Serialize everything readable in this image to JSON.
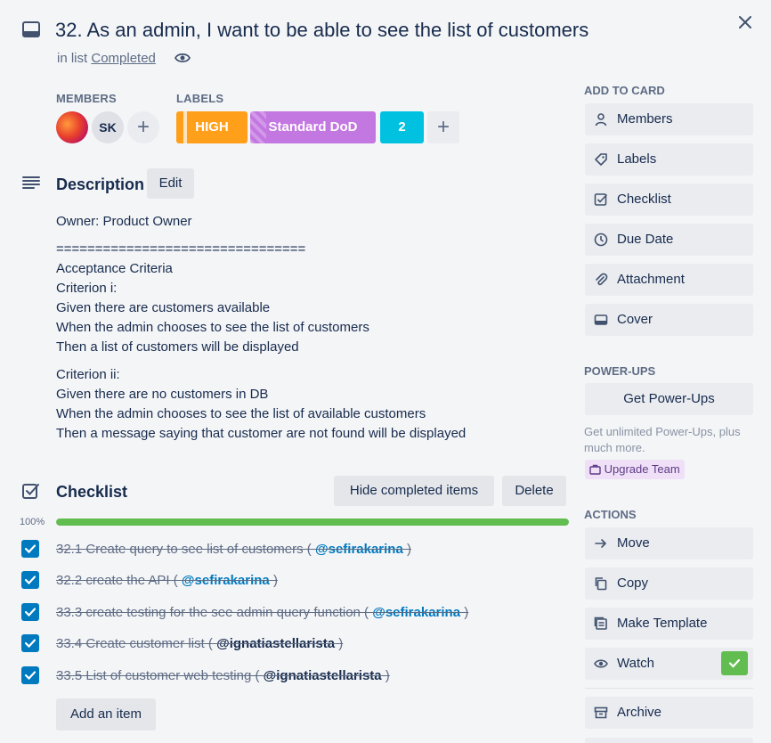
{
  "card": {
    "title": "32. As an admin, I want to be able to see the list of customers",
    "in_list_prefix": "in list",
    "list_name": "Completed"
  },
  "members": {
    "heading": "MEMBERS",
    "initials": "SK"
  },
  "labels": {
    "heading": "LABELS",
    "items": [
      {
        "text": "HIGH",
        "color": "#ff9f1a"
      },
      {
        "text": "Standard DoD",
        "color": "#c377e0"
      },
      {
        "text": "2",
        "color": "#00c2e0"
      }
    ]
  },
  "description": {
    "heading": "Description",
    "edit_label": "Edit",
    "lines": [
      "Owner: Product Owner",
      "================================",
      "Acceptance Criteria",
      "Criterion i:",
      "Given there are customers available",
      "When the admin chooses to see the list of customers",
      "Then a list of customers will be displayed",
      "Criterion ii:",
      "Given there are no customers in DB",
      "When the admin chooses to see the list of available customers",
      "Then a message saying that customer are not found will be displayed"
    ]
  },
  "checklist": {
    "heading": "Checklist",
    "hide_label": "Hide completed items",
    "delete_label": "Delete",
    "progress_label": "100%",
    "progress": 1.0,
    "items": [
      {
        "text": "32.1 Create query to see list of customers ( ",
        "mention": "@sefirakarina",
        "suffix": " )",
        "checked": true
      },
      {
        "text": "32.2 create the API ( ",
        "mention": "@sefirakarina",
        "suffix": " )",
        "checked": true
      },
      {
        "text": "33.3 create testing for the see admin query function ( ",
        "mention": "@sefirakarina",
        "suffix": " )",
        "checked": true
      },
      {
        "text": "33.4 Create customer list ( ",
        "mention": "@ignatiastellarista",
        "suffix": " )",
        "checked": true
      },
      {
        "text": "33.5 List of customer web testing ( ",
        "mention": "@ignatiastellarista",
        "suffix": " )",
        "checked": true
      }
    ],
    "add_item_label": "Add an item"
  },
  "sidebar": {
    "add_to_card_heading": "ADD TO CARD",
    "add_to_card": [
      {
        "label": "Members",
        "icon": "person-icon"
      },
      {
        "label": "Labels",
        "icon": "tag-icon"
      },
      {
        "label": "Checklist",
        "icon": "checklist-icon"
      },
      {
        "label": "Due Date",
        "icon": "clock-icon"
      },
      {
        "label": "Attachment",
        "icon": "paperclip-icon"
      },
      {
        "label": "Cover",
        "icon": "cover-icon"
      }
    ],
    "powerups_heading": "POWER-UPS",
    "get_powerups_label": "Get Power-Ups",
    "powerups_note": "Get unlimited Power-Ups, plus much more.",
    "upgrade_label": "Upgrade Team",
    "actions_heading": "ACTIONS",
    "actions": [
      {
        "label": "Move",
        "icon": "arrow-right-icon"
      },
      {
        "label": "Copy",
        "icon": "copy-icon"
      },
      {
        "label": "Make Template",
        "icon": "template-icon"
      },
      {
        "label": "Watch",
        "icon": "eye-icon"
      },
      {
        "label": "Archive",
        "icon": "archive-icon"
      }
    ]
  }
}
